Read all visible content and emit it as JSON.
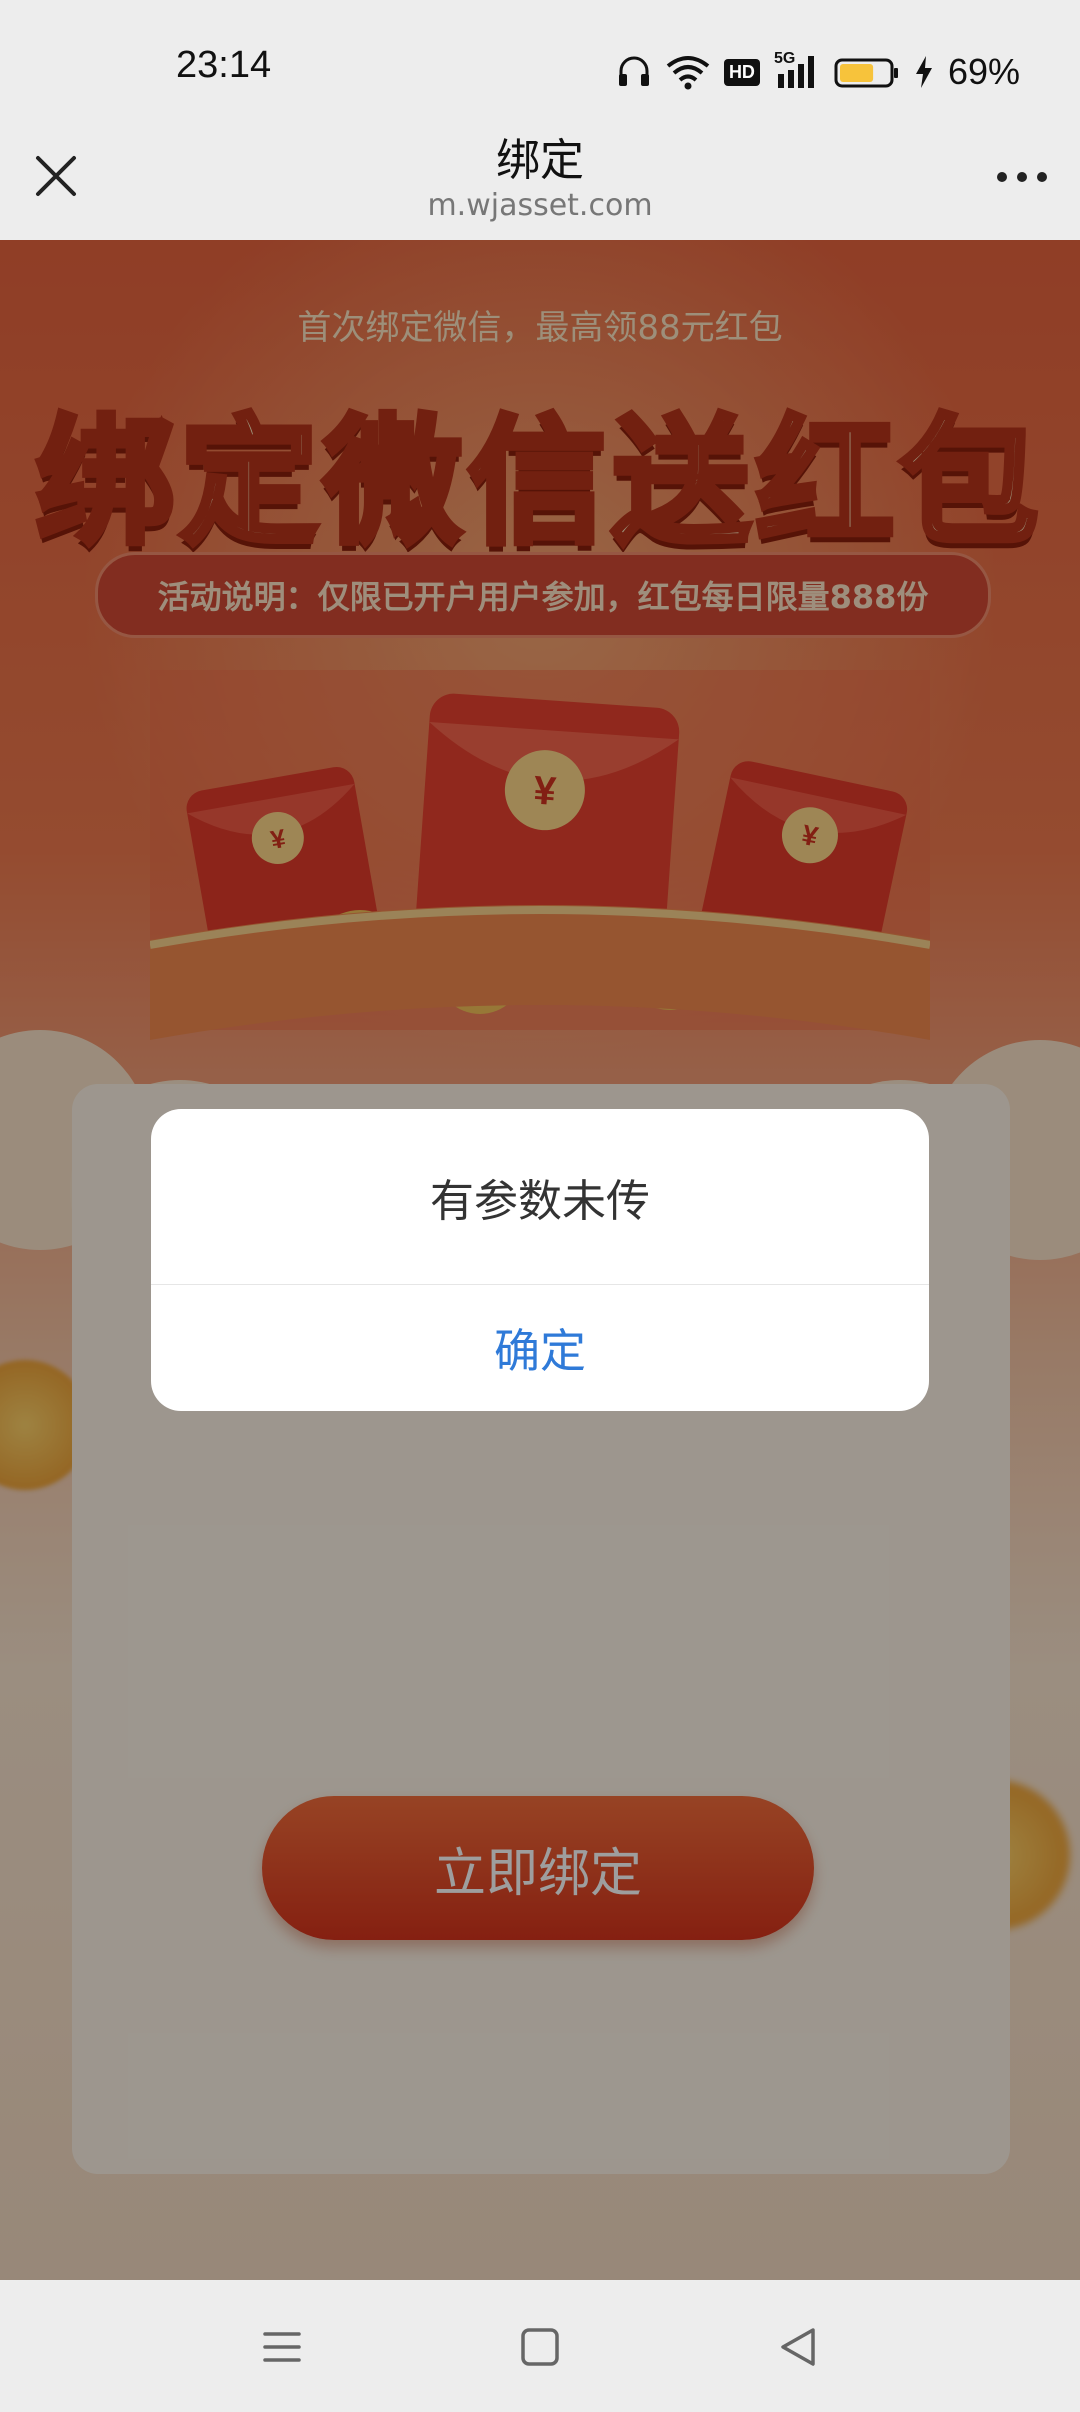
{
  "status_bar": {
    "time": "23:14",
    "network": "5G",
    "hd_badge": "HD",
    "battery_percent": "69%",
    "battery_level": 0.69,
    "battery_color": "#f7c33b"
  },
  "nav": {
    "title": "绑定",
    "url": "m.wjasset.com"
  },
  "page": {
    "subtitle": "首次绑定微信，最高领88元红包",
    "headline": "绑定微信送红包",
    "notice": "活动说明：仅限已开户用户参加，红包每日限量888份",
    "bind_button": "立即绑定",
    "yuan_symbol": "¥"
  },
  "dialog": {
    "message": "有参数未传",
    "confirm": "确定"
  },
  "colors": {
    "accent_blue": "#2f7ad8",
    "primary_red": "#d7341c"
  }
}
